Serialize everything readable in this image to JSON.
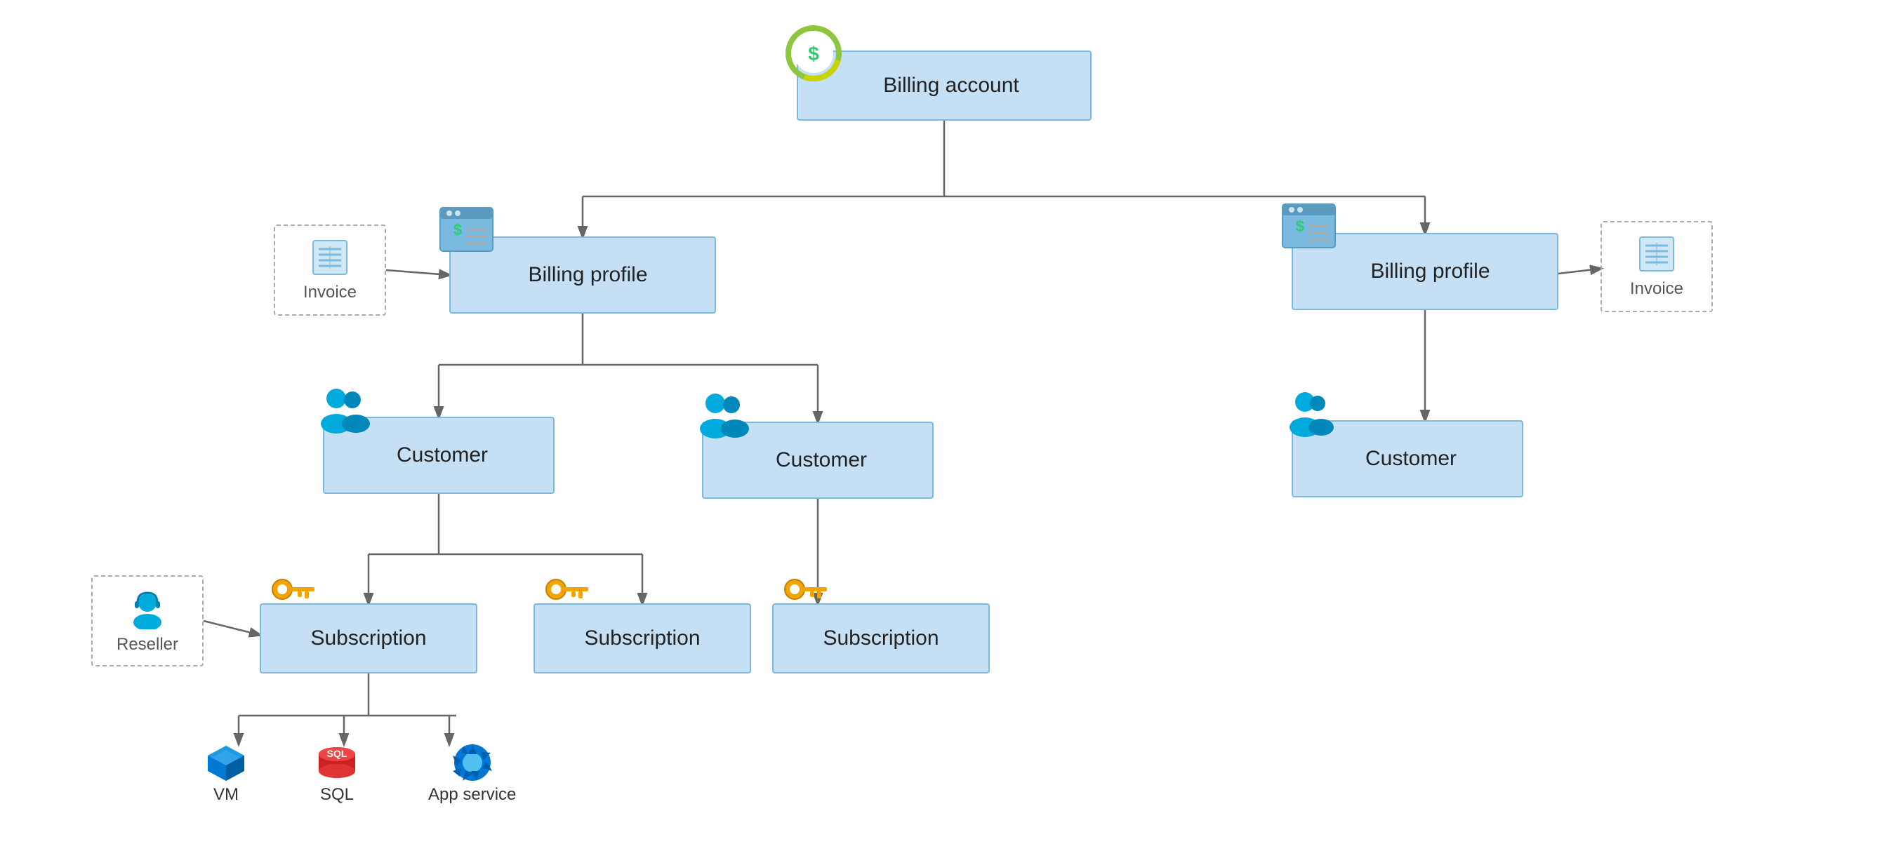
{
  "nodes": {
    "billing_account": {
      "label": "Billing account"
    },
    "billing_profile_left": {
      "label": "Billing profile"
    },
    "billing_profile_right": {
      "label": "Billing profile"
    },
    "customer_1": {
      "label": "Customer"
    },
    "customer_2": {
      "label": "Customer"
    },
    "customer_3": {
      "label": "Customer"
    },
    "subscription_1": {
      "label": "Subscription"
    },
    "subscription_2": {
      "label": "Subscription"
    },
    "subscription_3": {
      "label": "Subscription"
    }
  },
  "dashed_boxes": {
    "invoice_left": {
      "label": "Invoice"
    },
    "invoice_right": {
      "label": "Invoice"
    },
    "reseller": {
      "label": "Reseller"
    }
  },
  "services": {
    "vm": {
      "label": "VM"
    },
    "sql": {
      "label": "SQL"
    },
    "app_service": {
      "label": "App service"
    }
  },
  "colors": {
    "node_bg": "#c5e0f5",
    "node_border": "#7ab9e0",
    "line": "#666",
    "dashed": "#aaa"
  }
}
